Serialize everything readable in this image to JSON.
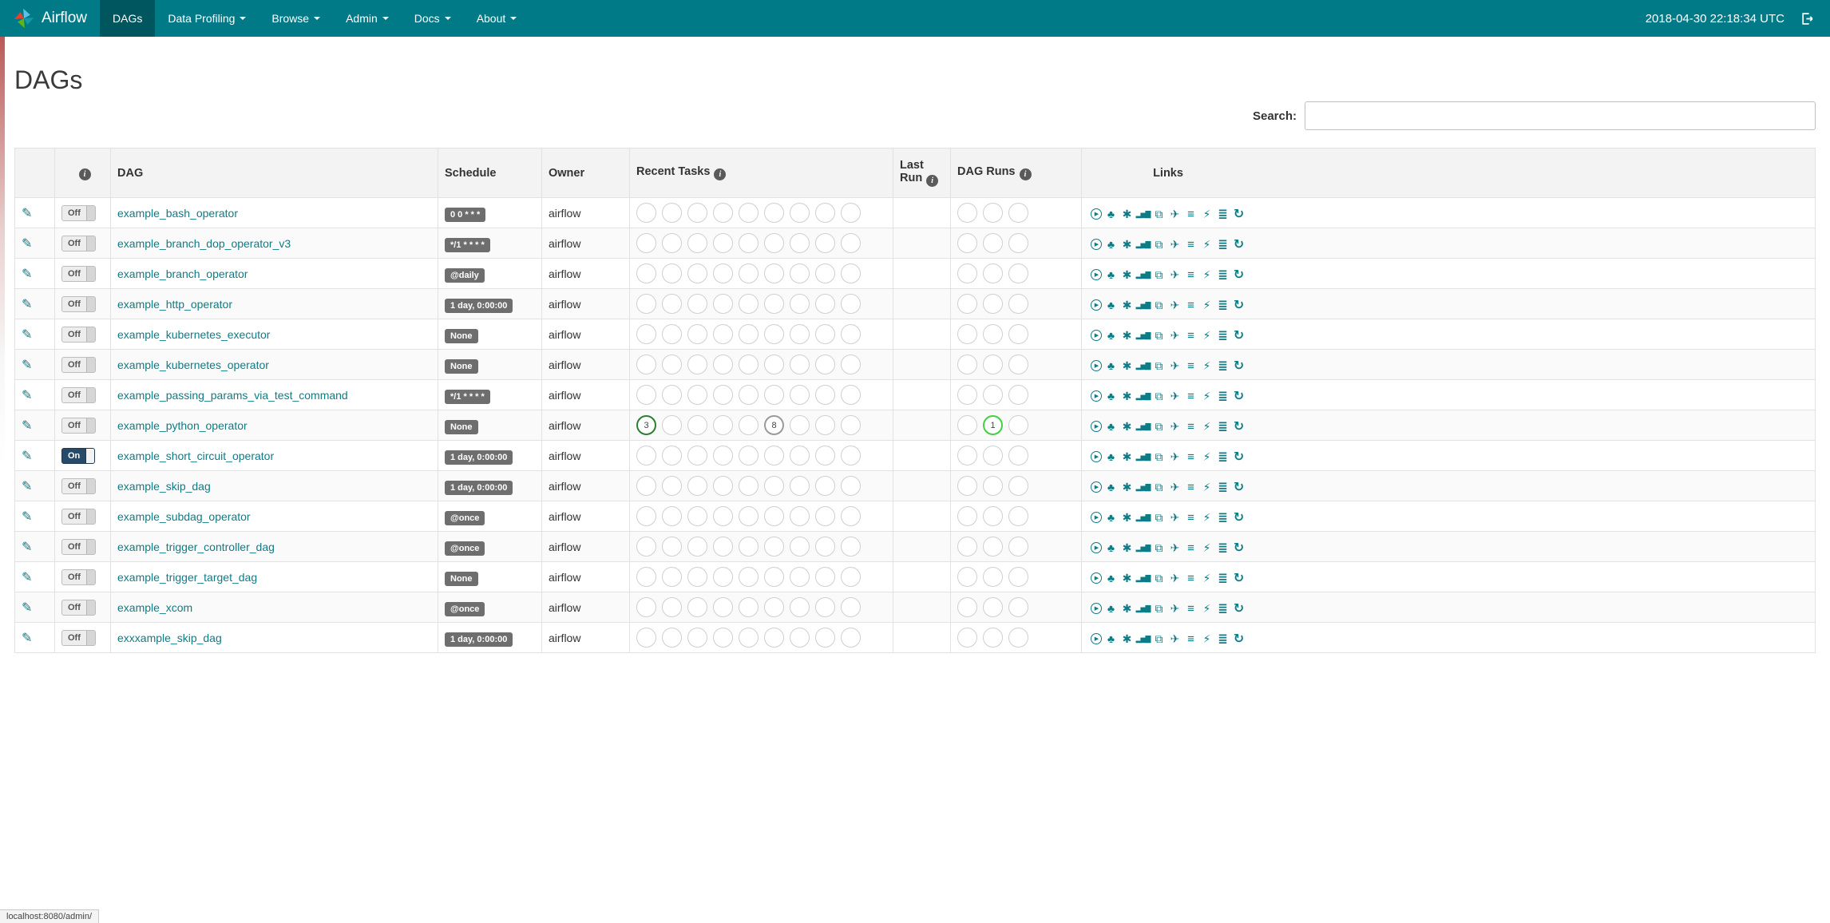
{
  "navbar": {
    "brand": "Airflow",
    "items": [
      {
        "label": "DAGs",
        "active": true,
        "dropdown": false
      },
      {
        "label": "Data Profiling",
        "active": false,
        "dropdown": true
      },
      {
        "label": "Browse",
        "active": false,
        "dropdown": true
      },
      {
        "label": "Admin",
        "active": false,
        "dropdown": true
      },
      {
        "label": "Docs",
        "active": false,
        "dropdown": true
      },
      {
        "label": "About",
        "active": false,
        "dropdown": true
      }
    ],
    "clock": "2018-04-30 22:18:34 UTC"
  },
  "page": {
    "title": "DAGs",
    "search_label": "Search:",
    "status_bar": "localhost:8080/admin/"
  },
  "colors": {
    "navbar": "#007a87",
    "navbar-active": "#00565f",
    "link": "#0e7c86",
    "badge": "#6e6e6e",
    "toggle-on": "#264a67",
    "success": "#2e7d32",
    "running": "#44cf44",
    "neutral": "#9a9a9a"
  },
  "table": {
    "headers": {
      "dag": "DAG",
      "schedule": "Schedule",
      "owner": "Owner",
      "recent_tasks": "Recent Tasks",
      "last_run": "Last Run",
      "dag_runs": "DAG Runs",
      "links": "Links"
    },
    "recent_tasks_slots": 9,
    "dag_runs_slots": 3,
    "links_icons": [
      {
        "name": "trigger-dag-icon",
        "glyph": "▶",
        "title": "Trigger Dag"
      },
      {
        "name": "tree-view-icon",
        "glyph": "♣",
        "title": "Tree View"
      },
      {
        "name": "graph-view-icon",
        "glyph": "✱",
        "title": "Graph View"
      },
      {
        "name": "task-duration-icon",
        "glyph": "▂▅▇",
        "title": "Task Duration"
      },
      {
        "name": "task-tries-icon",
        "glyph": "⧉",
        "title": "Task Tries"
      },
      {
        "name": "landing-times-icon",
        "glyph": "✈",
        "title": "Landing Times"
      },
      {
        "name": "gantt-icon",
        "glyph": "≡",
        "title": "Gantt View"
      },
      {
        "name": "code-view-icon",
        "glyph": "⚡",
        "title": "Code View"
      },
      {
        "name": "logs-icon",
        "glyph": "≣",
        "title": "Logs"
      },
      {
        "name": "refresh-icon",
        "glyph": "↻",
        "title": "Refresh"
      }
    ],
    "rows": [
      {
        "dag_id": "example_bash_operator",
        "toggle": "Off",
        "schedule": "0 0 * * *",
        "owner": "airflow",
        "last_run": "",
        "recent_tasks": [],
        "dag_runs": []
      },
      {
        "dag_id": "example_branch_dop_operator_v3",
        "toggle": "Off",
        "schedule": "*/1 * * * *",
        "owner": "airflow",
        "last_run": "",
        "recent_tasks": [],
        "dag_runs": []
      },
      {
        "dag_id": "example_branch_operator",
        "toggle": "Off",
        "schedule": "@daily",
        "owner": "airflow",
        "last_run": "",
        "recent_tasks": [],
        "dag_runs": []
      },
      {
        "dag_id": "example_http_operator",
        "toggle": "Off",
        "schedule": "1 day, 0:00:00",
        "owner": "airflow",
        "last_run": "",
        "recent_tasks": [],
        "dag_runs": []
      },
      {
        "dag_id": "example_kubernetes_executor",
        "toggle": "Off",
        "schedule": "None",
        "owner": "airflow",
        "last_run": "",
        "recent_tasks": [],
        "dag_runs": []
      },
      {
        "dag_id": "example_kubernetes_operator",
        "toggle": "Off",
        "schedule": "None",
        "owner": "airflow",
        "last_run": "",
        "recent_tasks": [],
        "dag_runs": []
      },
      {
        "dag_id": "example_passing_params_via_test_command",
        "toggle": "Off",
        "schedule": "*/1 * * * *",
        "owner": "airflow",
        "last_run": "",
        "recent_tasks": [],
        "dag_runs": []
      },
      {
        "dag_id": "example_python_operator",
        "toggle": "Off",
        "schedule": "None",
        "owner": "airflow",
        "last_run": "",
        "recent_tasks": [
          {
            "slot": 0,
            "count": "3",
            "color": "#2e7d32"
          },
          {
            "slot": 5,
            "count": "8",
            "color": "#9a9a9a"
          }
        ],
        "dag_runs": [
          {
            "slot": 1,
            "count": "1",
            "color": "#44cf44"
          }
        ]
      },
      {
        "dag_id": "example_short_circuit_operator",
        "toggle": "On",
        "schedule": "1 day, 0:00:00",
        "owner": "airflow",
        "last_run": "",
        "recent_tasks": [],
        "dag_runs": []
      },
      {
        "dag_id": "example_skip_dag",
        "toggle": "Off",
        "schedule": "1 day, 0:00:00",
        "owner": "airflow",
        "last_run": "",
        "recent_tasks": [],
        "dag_runs": []
      },
      {
        "dag_id": "example_subdag_operator",
        "toggle": "Off",
        "schedule": "@once",
        "owner": "airflow",
        "last_run": "",
        "recent_tasks": [],
        "dag_runs": []
      },
      {
        "dag_id": "example_trigger_controller_dag",
        "toggle": "Off",
        "schedule": "@once",
        "owner": "airflow",
        "last_run": "",
        "recent_tasks": [],
        "dag_runs": []
      },
      {
        "dag_id": "example_trigger_target_dag",
        "toggle": "Off",
        "schedule": "None",
        "owner": "airflow",
        "last_run": "",
        "recent_tasks": [],
        "dag_runs": []
      },
      {
        "dag_id": "example_xcom",
        "toggle": "Off",
        "schedule": "@once",
        "owner": "airflow",
        "last_run": "",
        "recent_tasks": [],
        "dag_runs": []
      },
      {
        "dag_id": "exxxample_skip_dag",
        "toggle": "Off",
        "schedule": "1 day, 0:00:00",
        "owner": "airflow",
        "last_run": "",
        "recent_tasks": [],
        "dag_runs": []
      }
    ]
  }
}
